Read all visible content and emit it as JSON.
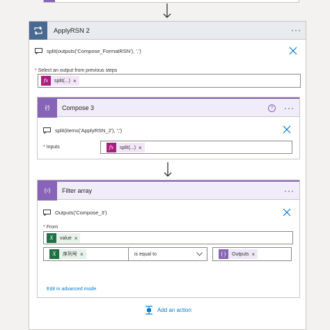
{
  "apply_rsn2": {
    "title": "ApplyRSN 2",
    "menu": "···",
    "expression": "split(outputs('Compose_FormatRSN'), ',')",
    "select_label_req": "*",
    "select_label": "Select an output from previous steps",
    "token_label": "split(...)",
    "token_remove": "×"
  },
  "compose3": {
    "title": "Compose 3",
    "help": "?",
    "menu": "···",
    "expression": "split(items('ApplyRSN_2'), ';')",
    "inputs_req": "*",
    "inputs_label": "Inputs",
    "token_label": "split(...)",
    "token_remove": "×"
  },
  "filter_array": {
    "title": "Filter array",
    "menu": "···",
    "expression": "Outputs('Compose_3')",
    "from_req": "*",
    "from_label": "From",
    "from_token_label": "value",
    "from_token_remove": "×",
    "left_token_label": "序列号",
    "left_token_remove": "×",
    "operator_value": "is equal to",
    "right_token_label": "Outputs",
    "right_token_remove": "×",
    "advanced_link": "Edit in advanced mode"
  },
  "add_action_label": "Add an action",
  "colors": {
    "accent_purple": "#8764b8",
    "apply_header": "#486991",
    "expression_token": "#aa1e7f",
    "excel_green": "#1e7145",
    "link_blue": "#0078d4"
  },
  "icons": {
    "loop": "loop-icon",
    "compose": "compose-icon",
    "filter": "filter-icon",
    "message": "message-icon",
    "close": "close-icon",
    "fx": "fx-icon",
    "excel": "excel-icon",
    "add": "add-action-icon",
    "chevron": "chevron-down-icon",
    "arrow": "arrow-down-icon"
  }
}
